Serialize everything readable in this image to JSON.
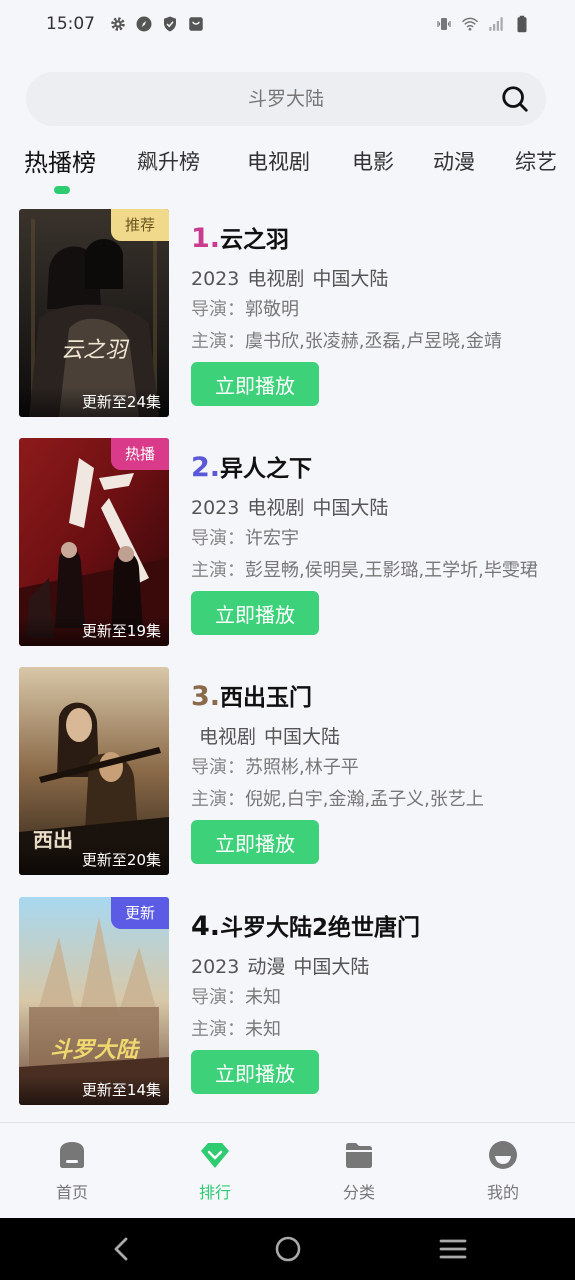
{
  "status": {
    "time": "15:07"
  },
  "search": {
    "placeholder": "斗罗大陆"
  },
  "tabs": [
    {
      "label": "热播榜",
      "active": true
    },
    {
      "label": "飙升榜"
    },
    {
      "label": "电视剧"
    },
    {
      "label": "电影"
    },
    {
      "label": "动漫"
    },
    {
      "label": "综艺"
    }
  ],
  "items": [
    {
      "rank": "1.",
      "rank_color": "#c93b8f",
      "title": "云之羽",
      "year": "2023",
      "genre": "电视剧",
      "region": "中国大陆",
      "director_label": "导演：",
      "director": "郭敬明",
      "cast_label": "主演：",
      "cast": "虞书欣,张凌赫,丞磊,卢昱晓,金靖",
      "badge": "推荐",
      "badge_color": "#f0d98a",
      "badge_text_color": "#6a5520",
      "update": "更新至24集",
      "play_label": "立即播放"
    },
    {
      "rank": "2.",
      "rank_color": "#5a5ad8",
      "title": "异人之下",
      "year": "2023",
      "genre": "电视剧",
      "region": "中国大陆",
      "director_label": "导演：",
      "director": "许宏宇",
      "cast_label": "主演：",
      "cast": "彭昱畅,侯明昊,王影璐,王学圻,毕雯珺",
      "badge": "热播",
      "badge_color": "#d93b8a",
      "badge_text_color": "#ffffff",
      "update": "更新至19集",
      "play_label": "立即播放"
    },
    {
      "rank": "3.",
      "rank_color": "#8a6a4a",
      "title": "西出玉门",
      "year": "",
      "genre": "电视剧",
      "region": "中国大陆",
      "director_label": "导演：",
      "director": "苏照彬,林子平",
      "cast_label": "主演：",
      "cast": "倪妮,白宇,金瀚,孟子义,张艺上",
      "badge": "",
      "badge_color": "",
      "badge_text_color": "",
      "update": "更新至20集",
      "play_label": "立即播放"
    },
    {
      "rank": "4.",
      "rank_color": "#111111",
      "title": "斗罗大陆2绝世唐门",
      "year": "2023",
      "genre": "动漫",
      "region": "中国大陆",
      "director_label": "导演：",
      "director": "未知",
      "cast_label": "主演：",
      "cast": "未知",
      "badge": "更新",
      "badge_color": "#5b5be6",
      "badge_text_color": "#ffffff",
      "update": "更新至14集",
      "play_label": "立即播放"
    }
  ],
  "bottom_nav": [
    {
      "label": "首页",
      "icon": "home-icon"
    },
    {
      "label": "排行",
      "icon": "ranking-icon",
      "active": true
    },
    {
      "label": "分类",
      "icon": "folder-icon"
    },
    {
      "label": "我的",
      "icon": "profile-icon"
    }
  ],
  "colors": {
    "accent": "#2ecc71",
    "play_button": "#3dd17a"
  }
}
